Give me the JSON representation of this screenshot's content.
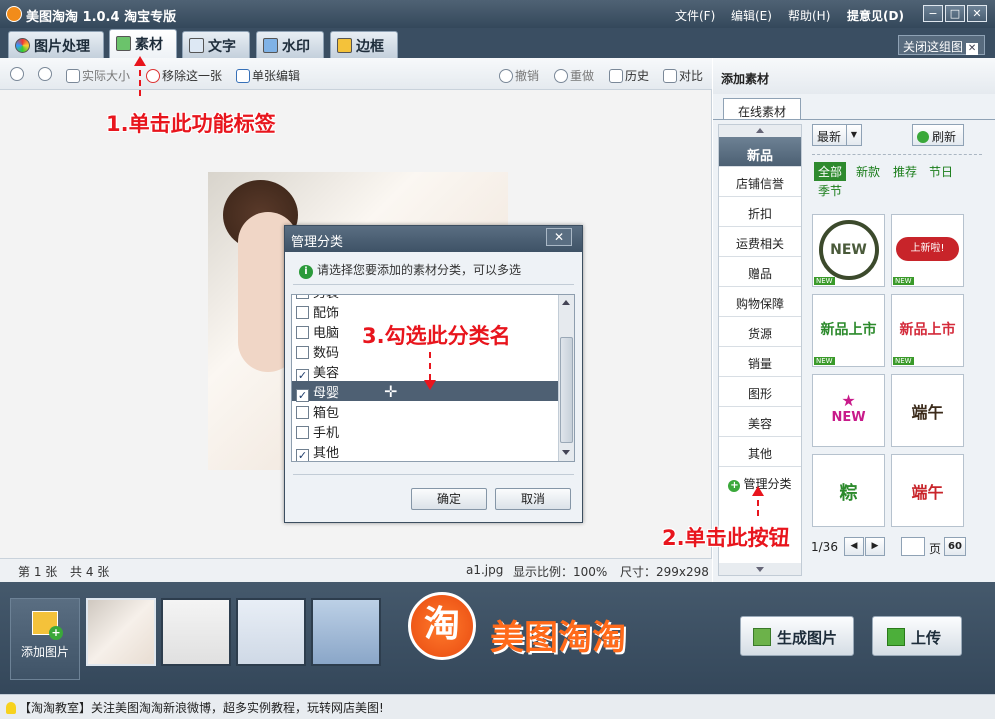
{
  "window": {
    "title": "美图淘淘 1.0.4 淘宝专版",
    "menus": [
      "文件(F)",
      "编辑(E)",
      "帮助(H)",
      "提意见(D)"
    ],
    "min": "−",
    "max": "□",
    "close": "✕"
  },
  "tabs": [
    {
      "label": "图片处理",
      "icon": "palette-icon"
    },
    {
      "label": "素材",
      "icon": "sticker-icon"
    },
    {
      "label": "文字",
      "icon": "text-icon"
    },
    {
      "label": "水印",
      "icon": "watermark-icon"
    },
    {
      "label": "边框",
      "icon": "frame-icon"
    }
  ],
  "close_all_label": "关闭这组图",
  "toolbar": {
    "actual_size": "实际大小",
    "remove_one": "移除这一张",
    "single_edit": "单张编辑",
    "undo": "撤销",
    "redo": "重做",
    "history": "历史",
    "compare": "对比"
  },
  "annotations": {
    "step1": "1.单击此功能标签",
    "step2": "2.单击此按钮",
    "step3": "3.勾选此分类名"
  },
  "dialog": {
    "title": "管理分类",
    "close": "✕",
    "hint": "请选择您要添加的素材分类，可以多选",
    "items": [
      {
        "label": "男装",
        "checked": false
      },
      {
        "label": "配饰",
        "checked": false
      },
      {
        "label": "电脑",
        "checked": false
      },
      {
        "label": "数码",
        "checked": false
      },
      {
        "label": "美容",
        "checked": true
      },
      {
        "label": "母婴",
        "checked": true
      },
      {
        "label": "箱包",
        "checked": false
      },
      {
        "label": "手机",
        "checked": false
      },
      {
        "label": "其他",
        "checked": true
      }
    ],
    "ok": "确定",
    "cancel": "取消"
  },
  "status": {
    "page": "第 1 张",
    "total": "共 4 张",
    "file": "a1.jpg",
    "zoom": "显示比例：100%",
    "size": "尺寸：299x298"
  },
  "thumbs": {
    "add_label": "添加图片"
  },
  "logo": {
    "glyph": "淘",
    "text": "美图淘淘"
  },
  "actions": {
    "generate": "生成图片",
    "upload": "上传"
  },
  "footer": "【淘淘教室】关注美图淘淘新浪微博，超多实例教程，玩转网店美图!",
  "side": {
    "header": "添加素材",
    "tab": "在线素材",
    "categories": [
      "新品",
      "店铺信誉",
      "折扣",
      "运费相关",
      "赠品",
      "购物保障",
      "货源",
      "销量",
      "图形",
      "美容",
      "其他"
    ],
    "manage": "管理分类",
    "sort": "最新",
    "refresh": "刷新",
    "filters": [
      "全部",
      "新款",
      "推荐",
      "节日",
      "季节"
    ],
    "new_tag": "NEW",
    "assets": [
      {
        "text": "NEW",
        "color": "#4a5a3a"
      },
      {
        "text": "上新啦!",
        "color": "#c8242a"
      },
      {
        "text": "新品上市",
        "color": "#2c8a2c"
      },
      {
        "text": "新品上市",
        "color": "#d42a3a"
      },
      {
        "text": "NEW",
        "color": "#c81a8a"
      },
      {
        "text": "端午",
        "color": "#3a2a1a"
      },
      {
        "text": "粽",
        "color": "#2c8a2c"
      },
      {
        "text": "端午",
        "color": "#c8242a"
      }
    ],
    "pager": "1/36",
    "page_unit": "页",
    "page_go": "60",
    "prev": "◀",
    "next": "▶"
  }
}
